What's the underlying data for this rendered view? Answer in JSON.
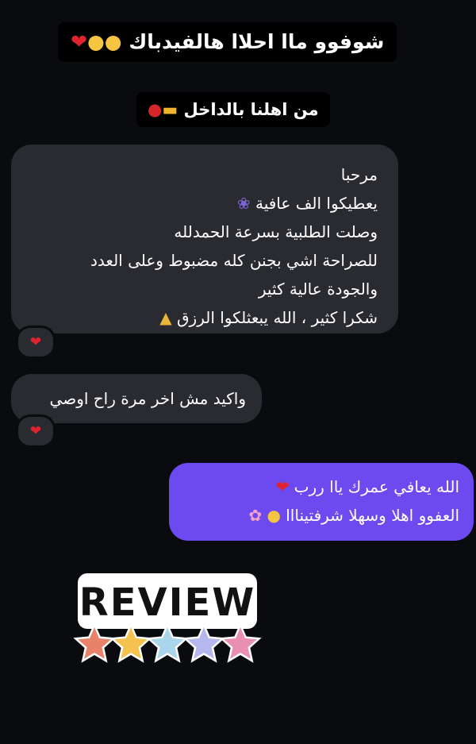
{
  "captions": {
    "top": "شوفوو ماا احلاا هالفيدباك",
    "sub": "من اهلنا بالداخل"
  },
  "messages": {
    "incoming_1": {
      "lines": [
        "مرحبا",
        "يعطيكوا الف عافية",
        "وصلت الطلبية  بسرعة الحمدلله",
        "للصراحة اشي  بجنن   كله مضبوط وعلى العدد",
        "والجودة عالية كثير",
        "شكرا كثير ، الله يبعثلكوا  الرزق"
      ],
      "reaction": "heart"
    },
    "incoming_2": {
      "text": "واكيد مش اخر مرة راح اوصي",
      "reaction": "heart"
    },
    "outgoing_1": {
      "lines": [
        "الله يعافي عمرك ياا ررب",
        "العفوو اهلا وسهلا شرفتينااا"
      ]
    }
  },
  "sticker": {
    "word": "REVIEW",
    "stars": 5,
    "star_colors": [
      "#e8826a",
      "#f5c14f",
      "#a9d6ea",
      "#b7b7ef",
      "#e98fb4"
    ]
  },
  "colors": {
    "background": "#0a0b0f",
    "incoming_bubble": "#2a2b30",
    "outgoing_bubble": "#6d4af0",
    "heart": "#e0242f"
  },
  "icons": {
    "heart": "heart-icon",
    "hugging_face": "hugging-face-icon",
    "truck": "delivery-truck-icon",
    "pin": "location-pin-icon",
    "hyacinth": "hyacinth-flower-icon",
    "praying_hands": "praying-hands-icon",
    "cherry_blossom": "cherry-blossom-icon"
  }
}
